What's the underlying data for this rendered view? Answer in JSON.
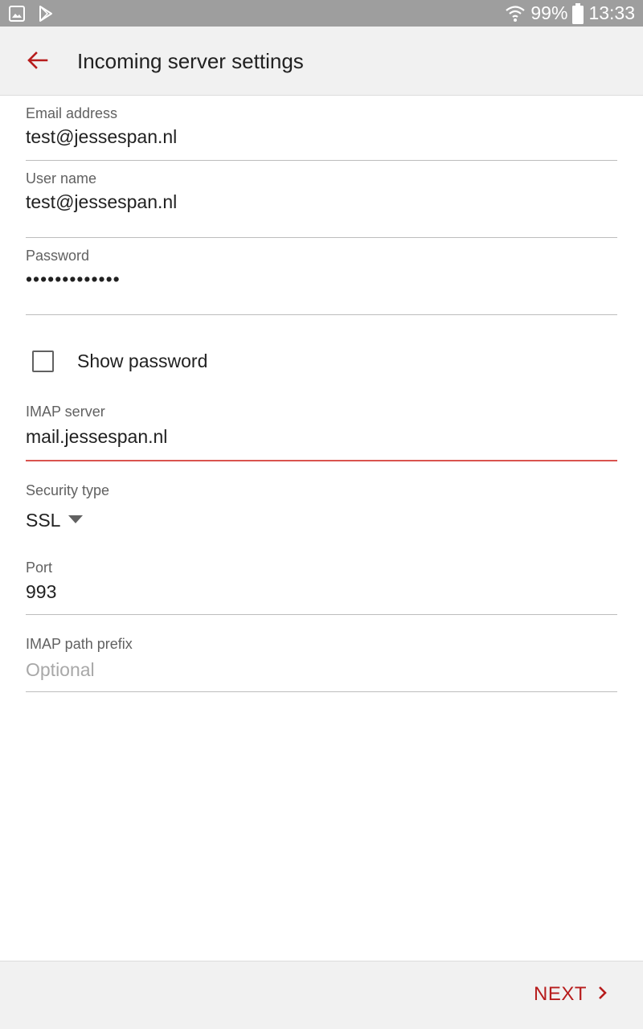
{
  "status_bar": {
    "battery": "99%",
    "time": "13:33",
    "icons": [
      "gallery-icon",
      "play-store-icon",
      "wifi-icon",
      "battery-icon"
    ]
  },
  "app_bar": {
    "title": "Incoming server settings",
    "back_icon": "arrow-back-icon"
  },
  "form": {
    "email": {
      "label": "Email address",
      "value": "test@jessespan.nl"
    },
    "username": {
      "label": "User name",
      "value": "test@jessespan.nl"
    },
    "password": {
      "label": "Password",
      "value": "•••••••••••••"
    },
    "show_password": {
      "label": "Show password",
      "checked": false
    },
    "imap_server": {
      "label": "IMAP server",
      "value": "mail.jessespan.nl"
    },
    "security_type": {
      "label": "Security type",
      "value": "SSL"
    },
    "port": {
      "label": "Port",
      "value": "993"
    },
    "imap_path_prefix": {
      "label": "IMAP path prefix",
      "value": "",
      "placeholder": "Optional"
    }
  },
  "footer": {
    "next_label": "NEXT"
  },
  "colors": {
    "accent": "#b71c1c",
    "active_underline": "#d9534f",
    "app_bar_bg": "#f1f1f1",
    "status_bar_bg": "#9e9e9e"
  }
}
